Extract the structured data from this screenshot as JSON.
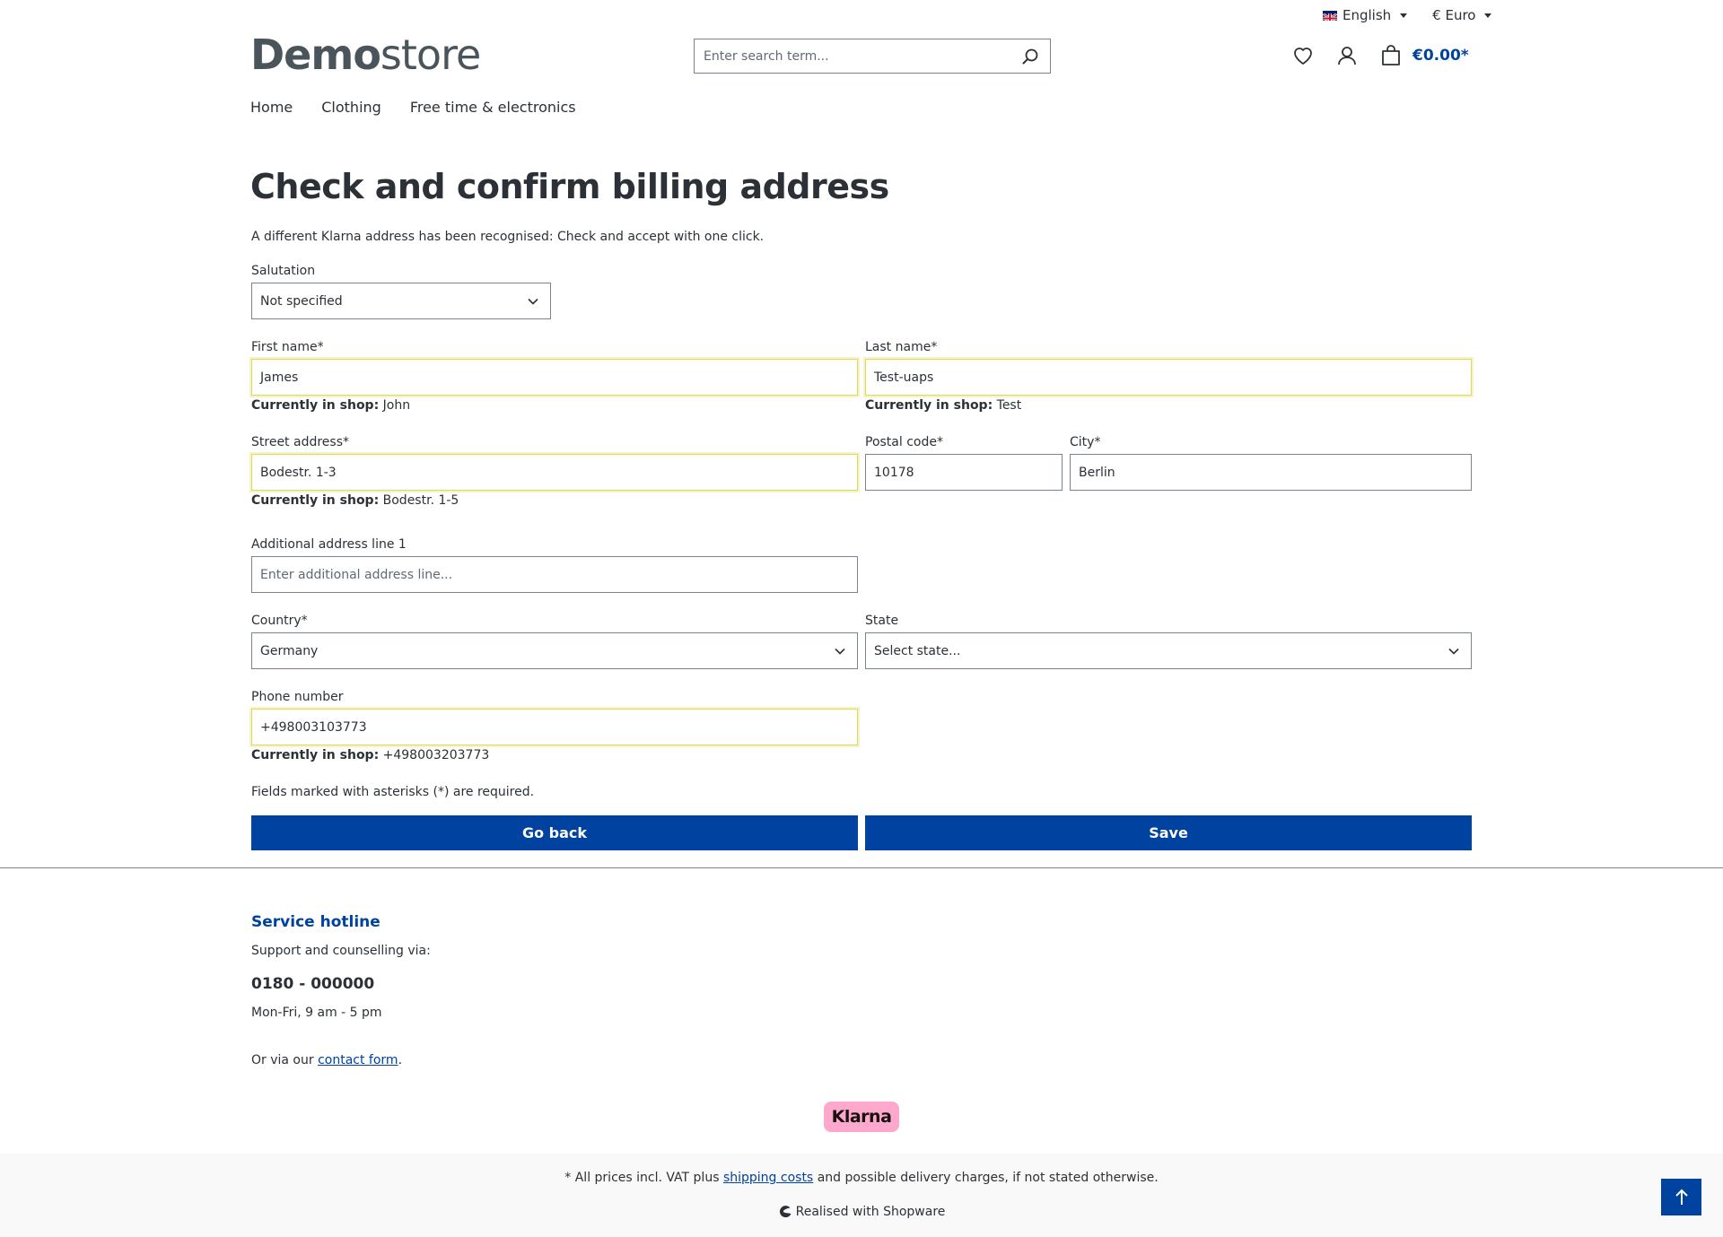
{
  "topbar": {
    "language": "English",
    "currency": "€ Euro"
  },
  "logo": {
    "bold": "Demo",
    "light": "store"
  },
  "search": {
    "placeholder": "Enter search term..."
  },
  "header": {
    "cart_total": "€0.00*"
  },
  "nav": {
    "items": [
      "Home",
      "Clothing",
      "Free time & electronics"
    ]
  },
  "page": {
    "title": "Check and confirm billing address",
    "intro": "A different Klarna address has been recognised: Check and accept with one click."
  },
  "form": {
    "salutation": {
      "label": "Salutation",
      "value": "Not specified"
    },
    "first_name": {
      "label": "First name*",
      "value": "James",
      "shop_label": "Currently in shop:",
      "shop_value": "John"
    },
    "last_name": {
      "label": "Last name*",
      "value": "Test-uaps",
      "shop_label": "Currently in shop:",
      "shop_value": "Test"
    },
    "street": {
      "label": "Street address*",
      "value": "Bodestr. 1-3",
      "shop_label": "Currently in shop:",
      "shop_value": "Bodestr. 1-5"
    },
    "postal": {
      "label": "Postal code*",
      "value": "10178"
    },
    "city": {
      "label": "City*",
      "value": "Berlin"
    },
    "additional": {
      "label": "Additional address line 1",
      "placeholder": "Enter additional address line..."
    },
    "country": {
      "label": "Country*",
      "value": "Germany"
    },
    "state": {
      "label": "State",
      "value": "Select state..."
    },
    "phone": {
      "label": "Phone number",
      "value": "+498003103773",
      "shop_label": "Currently in shop:",
      "shop_value": "+498003203773"
    },
    "required_note": "Fields marked with asterisks (*) are required.",
    "back_label": "Go back",
    "save_label": "Save"
  },
  "footer": {
    "hotline_title": "Service hotline",
    "support_text": "Support and counselling via:",
    "phone": "0180 - 000000",
    "hours": "Mon-Fri, 9 am - 5 pm",
    "contact_prefix": "Or via our",
    "contact_link": "contact form",
    "contact_suffix": ".",
    "klarna": "Klarna",
    "vat_prefix": "* All prices incl. VAT plus",
    "vat_link": "shipping costs",
    "vat_suffix": "and possible delivery charges, if not stated otherwise.",
    "realised": "Realised with Shopware"
  },
  "colors": {
    "primary": "#0042a0",
    "highlight": "#e0d85a",
    "klarna_pink": "#ffa8cd"
  }
}
